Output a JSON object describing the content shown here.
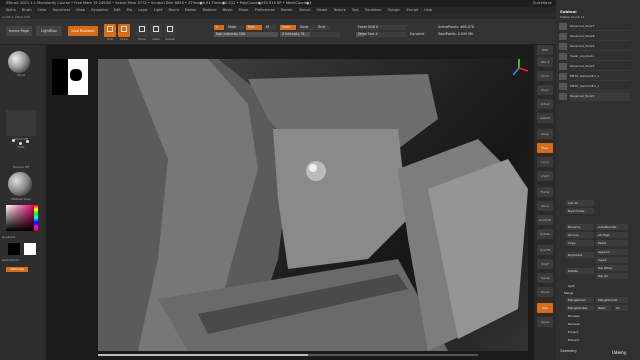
{
  "titlebar": {
    "text": "ZBrush 2021.1.1   Modularity Course   • Free Mem 19.245GB • Active Mem 5772 • Scratch Disk 6656 • ZTime●6.91 Timer●0.012 • PolyCount●474.914 KP • MeshCount●3",
    "quicksave": "QuickSave",
    "seethrough": "See-through 0",
    "menus": "Menus",
    "script": "DefaultZScript"
  },
  "menubar": [
    "Alpha",
    "Brush",
    "Color",
    "Document",
    "Draw",
    "Dynamics",
    "Edit",
    "File",
    "Layer",
    "Light",
    "Macro",
    "Marker",
    "Material",
    "Movie",
    "Picker",
    "Preferences",
    "Render",
    "Stencil",
    "Stroke",
    "Texture",
    "Tool",
    "Transform",
    "Zplugin",
    "Zscript",
    "Help"
  ],
  "coords": "0.295,0.166,0.228",
  "shelf": {
    "home": "Home Page",
    "lightbox": "LightBox",
    "live_boolean": "Live Boolean",
    "tools": [
      "Edit",
      "Draw",
      "Move",
      "Scale",
      "Rotate"
    ],
    "a_label": "A",
    "mrgb": "Mrgb",
    "rgb": "Rgb",
    "m": "M",
    "zadd": "Zadd",
    "zsub": "Zsub",
    "zcut": "Zcut",
    "rgb_intensity": "Rgb Intensity 100",
    "z_intensity": "Z Intensity 51",
    "focal_shift": "Focal Shift 0",
    "draw_size": "Draw Size 4",
    "dynamic": "Dynamic",
    "active_points": "ActivePoints: 469,070",
    "total_points": "TotalPoints: 0.595 Mil"
  },
  "leftpanel": {
    "brush": "Move",
    "stroke": "Dots",
    "alpha": "Alpha Off",
    "texture": "Texture Off",
    "material": "MatCap Gray",
    "gradient": "Gradient",
    "switch": "SwitchColor",
    "alternate": "Alternate"
  },
  "rightstrip": [
    "BPR",
    "SPix 3",
    "Scroll",
    "Zoom",
    "Actual",
    "AAHalf",
    "Persp",
    "Floor",
    "Local",
    "L.Sym",
    "Frame",
    "Move",
    "Zoom3D",
    "Rotate",
    "Line Fill",
    "PolyF",
    "Transp",
    "Ghost",
    "Solo",
    "Xpose"
  ],
  "subtool": {
    "title": "Subtool",
    "visible_count": "Visible Count 11",
    "items": [
      "Renamed_Tool27",
      "Renamed_Tool28",
      "Renamed_Tool29",
      "Spear_copytools",
      "Renamed_Tool29",
      "PM3D_Sphere3D3_1",
      "PM3D_Sphere3D3_1",
      "Renamed_Tool22"
    ],
    "list_all": "List All",
    "new_folder": "New Folder",
    "buttons": [
      [
        "Rename",
        "AutoReorder"
      ],
      [
        "All Low",
        "All High"
      ],
      [
        "Copy",
        "Paste"
      ],
      [
        "Duplicate",
        "Append"
      ],
      [
        "",
        "Insert"
      ],
      [
        "Delete",
        "Del Other"
      ],
      [
        "",
        "Del All"
      ],
      [
        "Split",
        ""
      ],
      [
        "Merge",
        ""
      ],
      [
        "MergeDown",
        "MergeSimilar"
      ],
      [
        "MergeVisible",
        "Weld",
        "Uv"
      ],
      [
        "Boolean",
        ""
      ],
      [
        "Remesh",
        ""
      ],
      [
        "Project",
        ""
      ],
      [
        "Extract",
        ""
      ]
    ],
    "geometry": "Geometry",
    "udemy": "Udemy"
  }
}
